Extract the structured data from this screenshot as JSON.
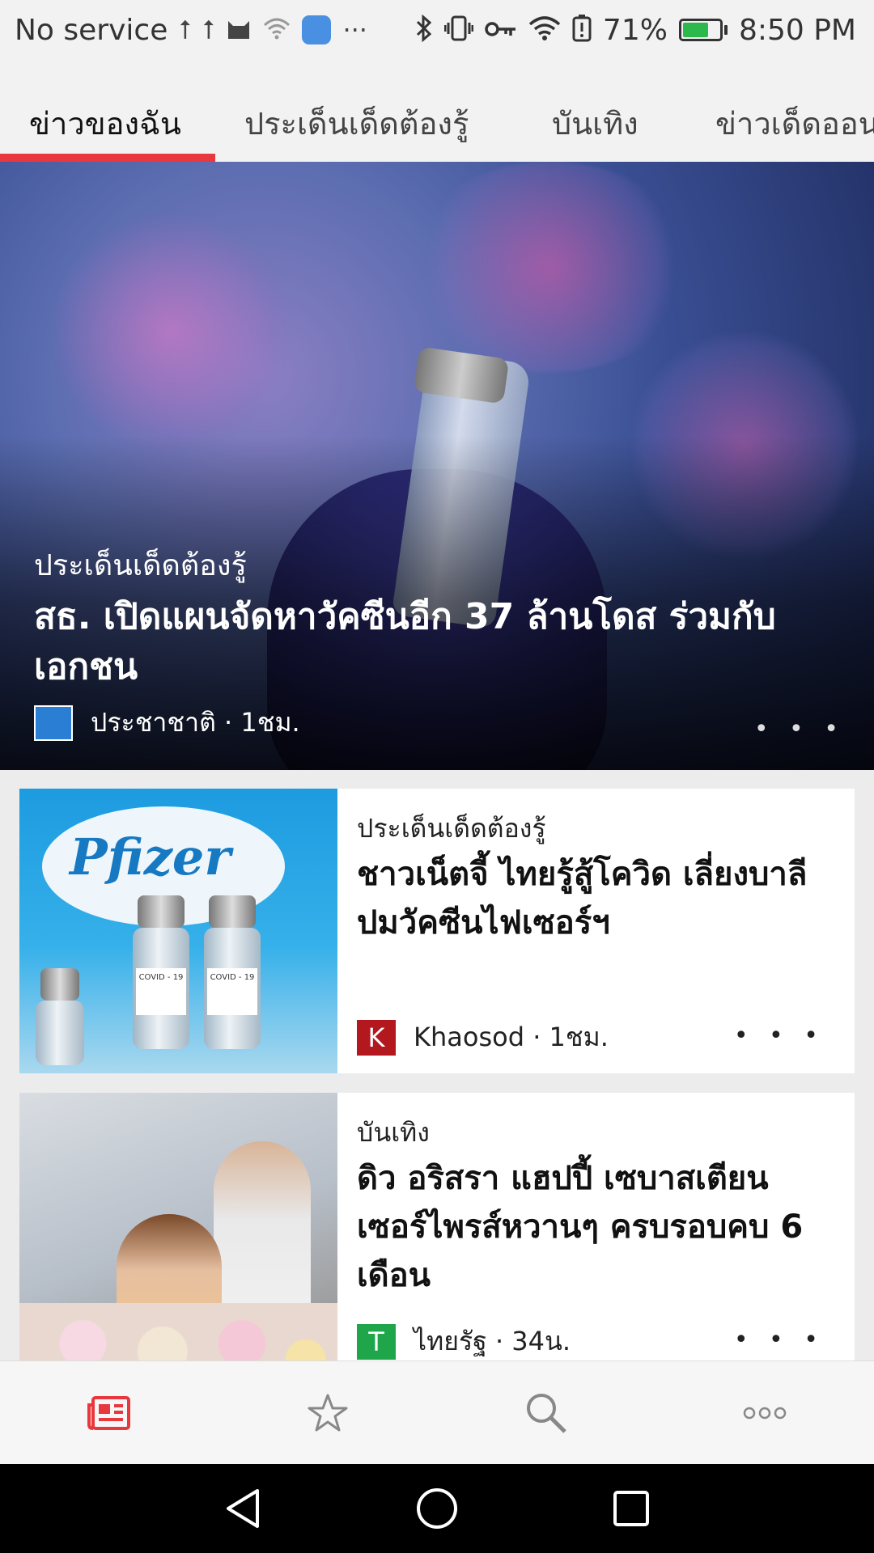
{
  "status_bar": {
    "carrier": "No service",
    "battery_percent": "71%",
    "battery_level": 0.71,
    "time": "8:50 PM",
    "icons_left": [
      "usb-icon",
      "usb-icon",
      "cat-app-icon",
      "wifi-off-icon",
      "app-icon",
      "more-notifications-icon"
    ],
    "icons_right": [
      "bluetooth-icon",
      "vibrate-icon",
      "key-icon",
      "wifi-icon",
      "battery-alert-icon",
      "battery-icon"
    ],
    "more_glyph": "···"
  },
  "tabs": [
    {
      "label": "ข่าวของฉัน",
      "active": true
    },
    {
      "label": "ประเด็นเด็ดต้องรู้",
      "active": false
    },
    {
      "label": "บันเทิง",
      "active": false
    },
    {
      "label": "ข่าวเด็ดออน",
      "active": false
    }
  ],
  "hero": {
    "category": "ประเด็นเด็ดต้องรู้",
    "title": "สธ. เปิดแผนจัดหาวัคซีนอีก 37 ล้านโดส ร่วมกับเอกชน",
    "source": "ประชาชาติ · 1ชม.",
    "more": "• • •"
  },
  "articles": [
    {
      "category": "ประเด็นเด็ดต้องรู้",
      "title": "ชาวเน็ตจี้ ไทยรู้สู้โควิด เลี่ยงบาลี ปมวัคซีนไฟเซอร์ฯ",
      "source": "Khaosod · 1ชม.",
      "logo_letter": "K",
      "logo_color": "#b3181e",
      "image_text": "Pfizer",
      "vial_label": "COVID - 19",
      "more": "• • •"
    },
    {
      "category": "บันเทิง",
      "title": "ดิว อริสรา แฮปปี้ เซบาสเตียน เซอร์ไพรส์หวานๆ ครบรอบคบ 6 เดือน",
      "source": "ไทยรัฐ · 34น.",
      "logo_letter": "T",
      "logo_color": "#1fa64a",
      "more": "• • •"
    }
  ],
  "bottom_nav": [
    {
      "name": "news-icon",
      "active": true
    },
    {
      "name": "star-icon",
      "active": false
    },
    {
      "name": "search-icon",
      "active": false
    },
    {
      "name": "more-icon",
      "active": false
    }
  ],
  "colors": {
    "accent": "#e8383d"
  }
}
